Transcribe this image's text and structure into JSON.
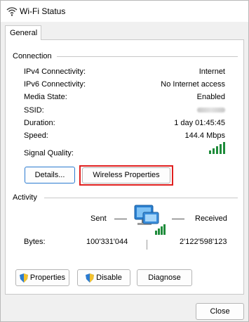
{
  "window": {
    "title": "Wi-Fi Status"
  },
  "tabs": [
    {
      "label": "General"
    }
  ],
  "connection": {
    "section_label": "Connection",
    "rows": [
      {
        "label": "IPv4 Connectivity:",
        "value": "Internet"
      },
      {
        "label": "IPv6 Connectivity:",
        "value": "No Internet access"
      },
      {
        "label": "Media State:",
        "value": "Enabled"
      },
      {
        "label": "SSID:",
        "value": ""
      },
      {
        "label": "Duration:",
        "value": "1 day 01:45:45"
      },
      {
        "label": "Speed:",
        "value": "144.4 Mbps"
      }
    ],
    "signal_label": "Signal Quality:",
    "signal_bars": 5,
    "details_button": "Details...",
    "wireless_properties_button": "Wireless Properties"
  },
  "activity": {
    "section_label": "Activity",
    "sent_label": "Sent",
    "received_label": "Received",
    "bytes_label": "Bytes:",
    "bytes_sent": "100'331'044",
    "bytes_received": "2'122'598'123"
  },
  "actions": {
    "properties_button": "Properties",
    "disable_button": "Disable",
    "diagnose_button": "Diagnose"
  },
  "footer": {
    "close_button": "Close"
  },
  "colors": {
    "accent": "#2b7bd0",
    "highlight": "#e0201f",
    "signal": "#1f8c3b"
  }
}
